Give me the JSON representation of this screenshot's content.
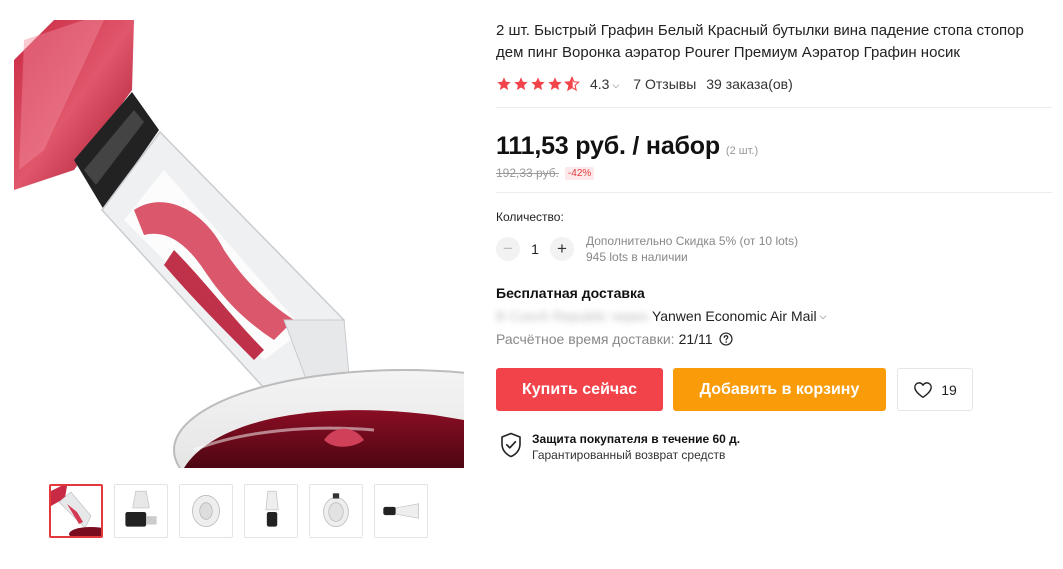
{
  "product": {
    "title": "2 шт. Быстрый Графин Белый Красный бутылки вина падение стопа стопор дем пинг Воронка аэратор Pourer Премиум Аэратор Графин носик",
    "rating": "4.3",
    "rating_stars": 4.3,
    "reviews": "7 Отзывы",
    "orders": "39 заказа(ов)"
  },
  "price": {
    "current": "111,53 руб. / набор",
    "unit_note": "(2 шт.)",
    "old": "192,33 руб.",
    "discount": "-42%"
  },
  "quantity": {
    "label": "Количество:",
    "minus": "−",
    "plus": "+",
    "value": "1",
    "discount_note": "Дополнительно Скидка 5% (от 10 lots)",
    "stock_note": "945 lots в наличии"
  },
  "shipping": {
    "title": "Бесплатная доставка",
    "from": "В Czech Republic через",
    "method": "Yanwen Economic Air Mail",
    "eta_label": "Расчётное время доставки:",
    "eta_value": "21/11"
  },
  "actions": {
    "buy": "Купить сейчас",
    "cart": "Добавить в корзину",
    "wish_count": "19"
  },
  "protection": {
    "title": "Защита покупателя в течение 60 д.",
    "subtitle": "Гарантированный возврат средств"
  },
  "gallery": {
    "thumbnail_count": 6,
    "active_index": 0
  },
  "colors": {
    "buy": "#f2434a",
    "cart": "#fa9b0a",
    "star": "#f2434a",
    "discount": "#e4393c"
  }
}
